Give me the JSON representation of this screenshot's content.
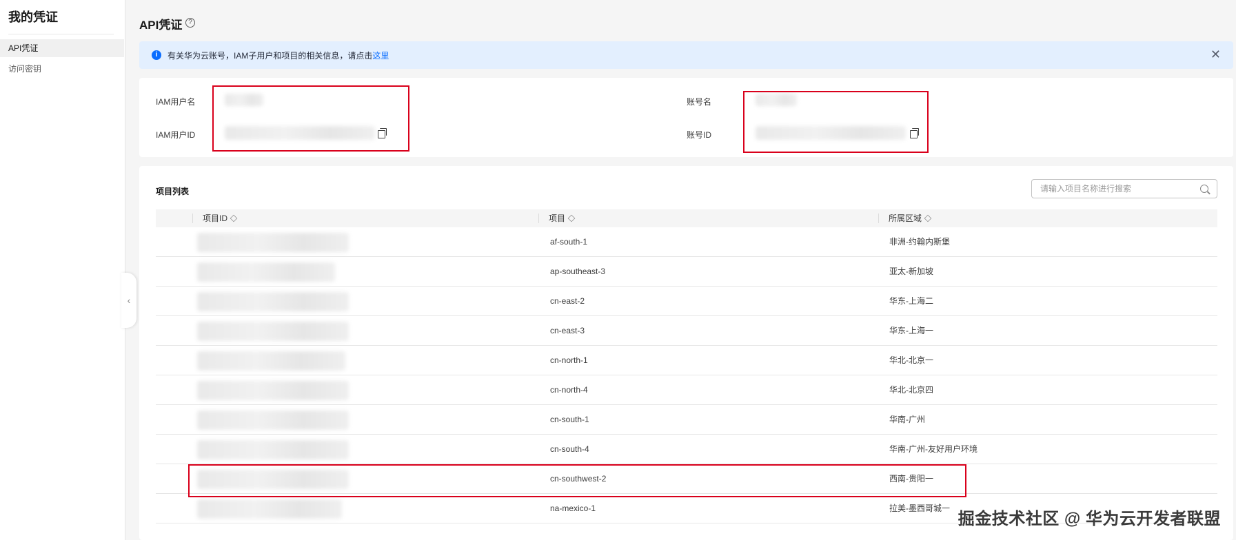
{
  "sidebar": {
    "title": "我的凭证",
    "items": [
      {
        "label": "API凭证",
        "active": true
      },
      {
        "label": "访问密钥",
        "active": false
      }
    ]
  },
  "header": {
    "title": "API凭证",
    "help_icon": "?"
  },
  "notice": {
    "icon": "i",
    "text": "有关华为云账号，IAM子用户和项目的相关信息，请点击",
    "link": "这里",
    "close_icon": "✕"
  },
  "credentials": {
    "iam_username_label": "IAM用户名",
    "iam_userid_label": "IAM用户ID",
    "account_name_label": "账号名",
    "account_id_label": "账号ID"
  },
  "projects": {
    "title": "项目列表",
    "search_placeholder": "请输入项目名称进行搜索",
    "columns": [
      "项目ID",
      "项目",
      "所属区域"
    ],
    "rows": [
      {
        "project": "af-south-1",
        "region": "非洲-约翰内斯堡"
      },
      {
        "project": "ap-southeast-3",
        "region": "亚太-新加坡"
      },
      {
        "project": "cn-east-2",
        "region": "华东-上海二"
      },
      {
        "project": "cn-east-3",
        "region": "华东-上海一"
      },
      {
        "project": "cn-north-1",
        "region": "华北-北京一"
      },
      {
        "project": "cn-north-4",
        "region": "华北-北京四"
      },
      {
        "project": "cn-south-1",
        "region": "华南-广州"
      },
      {
        "project": "cn-south-4",
        "region": "华南-广州-友好用户环境"
      },
      {
        "project": "cn-southwest-2",
        "region": "西南-贵阳一"
      },
      {
        "project": "na-mexico-1",
        "region": "拉美-墨西哥城一"
      }
    ]
  },
  "watermark": "掘金技术社区 @ 华为云开发者联盟",
  "colors": {
    "accent": "#0a6dff",
    "highlight": "#d9001b",
    "notice_bg": "#e3effe"
  }
}
